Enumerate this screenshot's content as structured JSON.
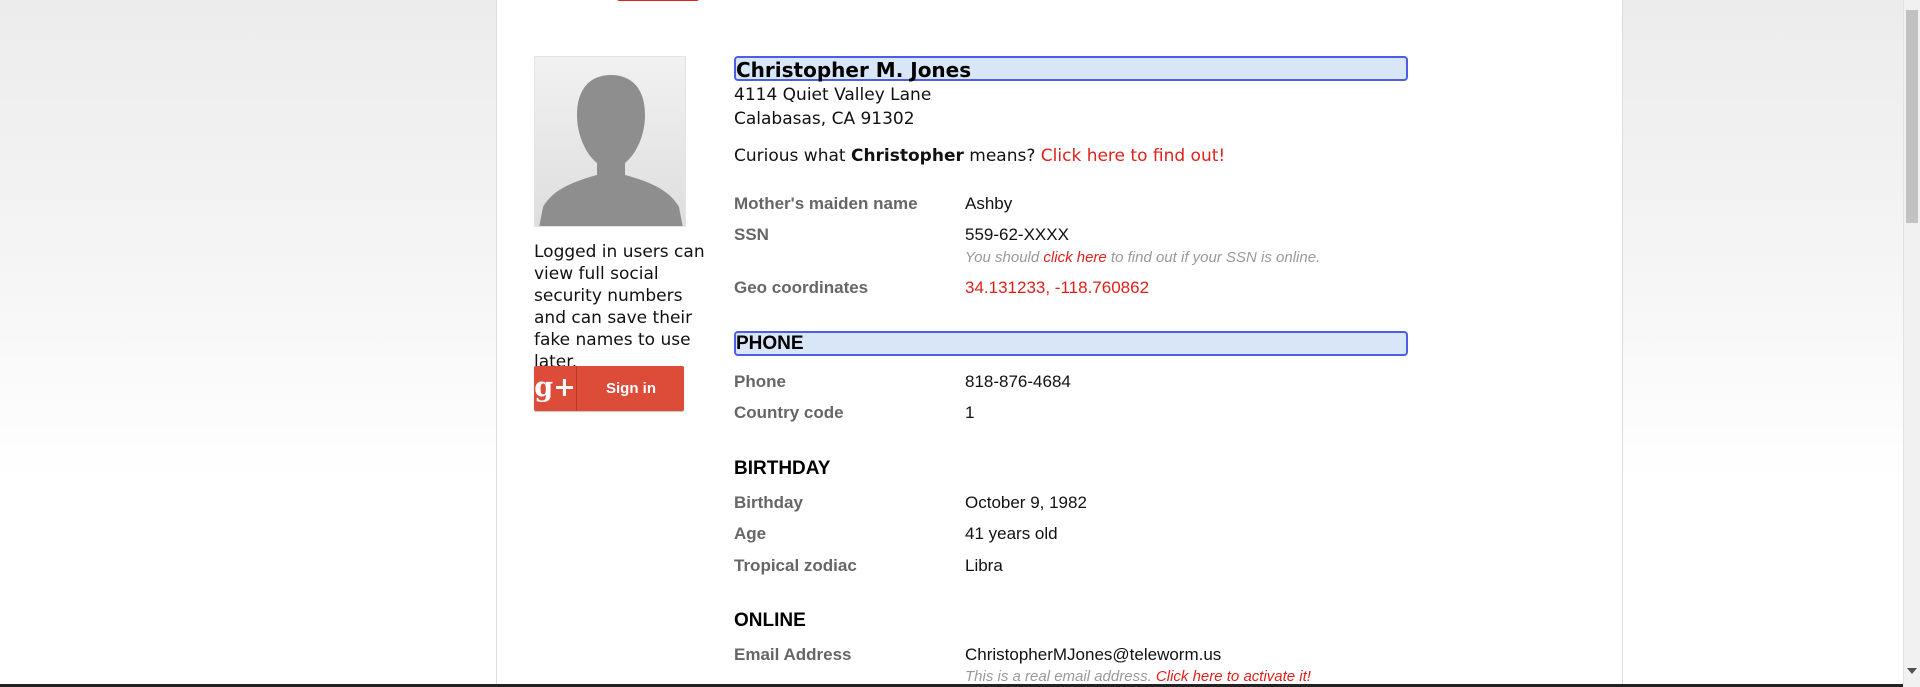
{
  "profile": {
    "name": "Christopher M. Jones",
    "address_line1": "4114 Quiet Valley Lane",
    "address_line2": "Calabasas, CA 91302",
    "curious_prefix": "Curious what ",
    "curious_name": "Christopher",
    "curious_suffix": " means? ",
    "curious_link": "Click here to find out!"
  },
  "sidebar": {
    "note": "Logged in users can view full social security numbers and can save their fake names to use later.",
    "gplus_icon": "g+",
    "signin_label": "Sign in"
  },
  "fields": {
    "maiden_label": "Mother's maiden name",
    "maiden_value": "Ashby",
    "ssn_label": "SSN",
    "ssn_value": "559-62-XXXX",
    "ssn_note_prefix": "You should ",
    "ssn_note_link": "click here",
    "ssn_note_suffix": " to find out if your SSN is online.",
    "geo_label": "Geo coordinates",
    "geo_value": "34.131233, -118.760862"
  },
  "phone": {
    "title": "PHONE",
    "phone_label": "Phone",
    "phone_value": "818-876-4684",
    "cc_label": "Country code",
    "cc_value": "1"
  },
  "birthday": {
    "title": "BIRTHDAY",
    "birthday_label": "Birthday",
    "birthday_value": "October 9, 1982",
    "age_label": "Age",
    "age_value": "41 years old",
    "zodiac_label": "Tropical zodiac",
    "zodiac_value": "Libra"
  },
  "online": {
    "title": "ONLINE",
    "email_label": "Email Address",
    "email_value": "ChristopherMJones@teleworm.us",
    "email_note_prefix": "This is a real email address. ",
    "email_note_link": "Click here to activate it!"
  },
  "colors": {
    "accent_red": "#e0201a",
    "highlight_border": "#4d5ee6",
    "highlight_fill": "#d9e6f7",
    "google_red": "#dd4b39"
  }
}
